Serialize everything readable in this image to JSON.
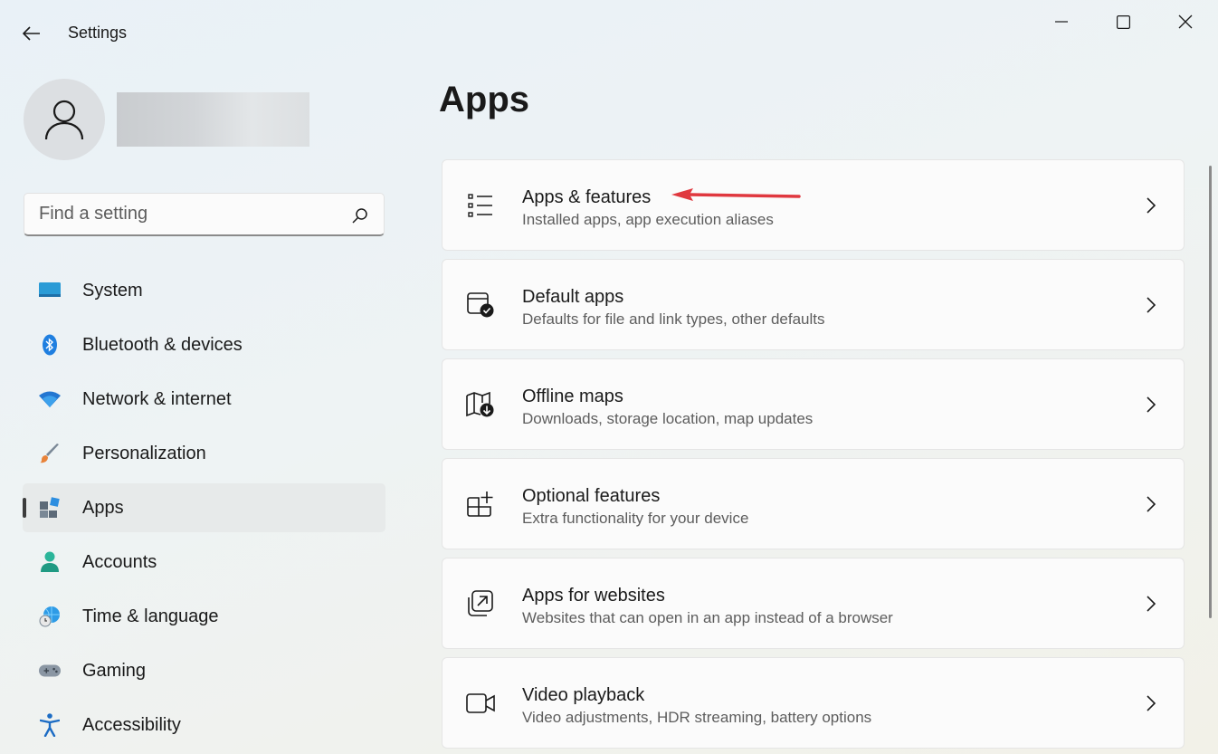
{
  "window": {
    "title": "Settings"
  },
  "search": {
    "placeholder": "Find a setting"
  },
  "sidebar": {
    "items": [
      {
        "label": "System",
        "icon": "monitor-icon"
      },
      {
        "label": "Bluetooth & devices",
        "icon": "bluetooth-icon"
      },
      {
        "label": "Network & internet",
        "icon": "wifi-icon"
      },
      {
        "label": "Personalization",
        "icon": "brush-icon"
      },
      {
        "label": "Apps",
        "icon": "apps-icon",
        "selected": true
      },
      {
        "label": "Accounts",
        "icon": "person-icon"
      },
      {
        "label": "Time & language",
        "icon": "globe-clock-icon"
      },
      {
        "label": "Gaming",
        "icon": "gamepad-icon"
      },
      {
        "label": "Accessibility",
        "icon": "accessibility-icon"
      }
    ]
  },
  "main": {
    "title": "Apps",
    "cards": [
      {
        "title": "Apps & features",
        "subtitle": "Installed apps, app execution aliases",
        "icon": "list-icon"
      },
      {
        "title": "Default apps",
        "subtitle": "Defaults for file and link types, other defaults",
        "icon": "default-apps-icon"
      },
      {
        "title": "Offline maps",
        "subtitle": "Downloads, storage location, map updates",
        "icon": "map-download-icon"
      },
      {
        "title": "Optional features",
        "subtitle": "Extra functionality for your device",
        "icon": "grid-add-icon"
      },
      {
        "title": "Apps for websites",
        "subtitle": "Websites that can open in an app instead of a browser",
        "icon": "open-external-icon"
      },
      {
        "title": "Video playback",
        "subtitle": "Video adjustments, HDR streaming, battery options",
        "icon": "video-camera-icon"
      }
    ]
  },
  "colors": {
    "annotation_arrow": "#e0383f",
    "accent": "#0067c0"
  }
}
